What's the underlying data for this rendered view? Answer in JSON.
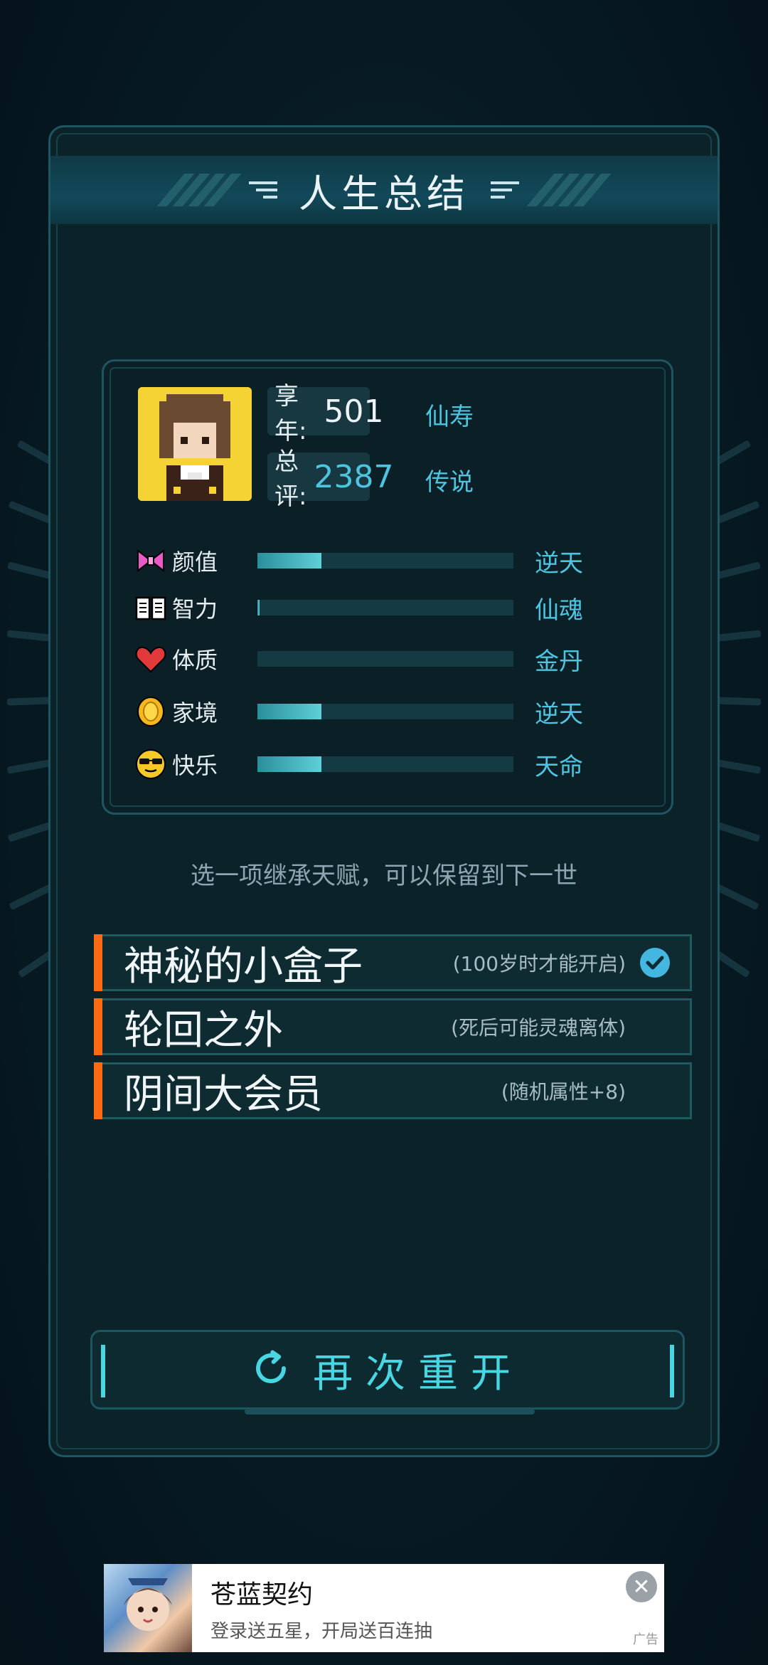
{
  "summary": {
    "title": "人生总结"
  },
  "stats": {
    "age_label": "享年:",
    "age_value": "501",
    "age_rank": "仙寿",
    "score_label": "总评:",
    "score_value": "2387",
    "score_rank": "传说"
  },
  "attributes": [
    {
      "label": "颜值",
      "icon": "bow-icon",
      "rank": "逆天",
      "fill": 0.25
    },
    {
      "label": "智力",
      "icon": "book-icon",
      "rank": "仙魂",
      "fill": 0.01
    },
    {
      "label": "体质",
      "icon": "heart-icon",
      "rank": "金丹",
      "fill": 0.0
    },
    {
      "label": "家境",
      "icon": "coin-icon",
      "rank": "逆天",
      "fill": 0.25
    },
    {
      "label": "快乐",
      "icon": "sunglasses-face-icon",
      "rank": "天命",
      "fill": 0.25
    }
  ],
  "hint": "选一项继承天赋，可以保留到下一世",
  "talents": [
    {
      "name": "神秘的小盒子",
      "desc": "(100岁时才能开启)",
      "selected": true
    },
    {
      "name": "轮回之外",
      "desc": "(死后可能灵魂离体)",
      "selected": false
    },
    {
      "name": "阴间大会员",
      "desc": "(随机属性+8)",
      "selected": false
    }
  ],
  "restart": {
    "label": "再次重开"
  },
  "ad": {
    "title": "苍蓝契约",
    "subtitle": "登录送五星，开局送百连抽",
    "tag": "广告"
  },
  "colors": {
    "accent": "#4ec4e0",
    "talent_marker": "#ff6a14",
    "avatar_bg": "#f5d334"
  }
}
